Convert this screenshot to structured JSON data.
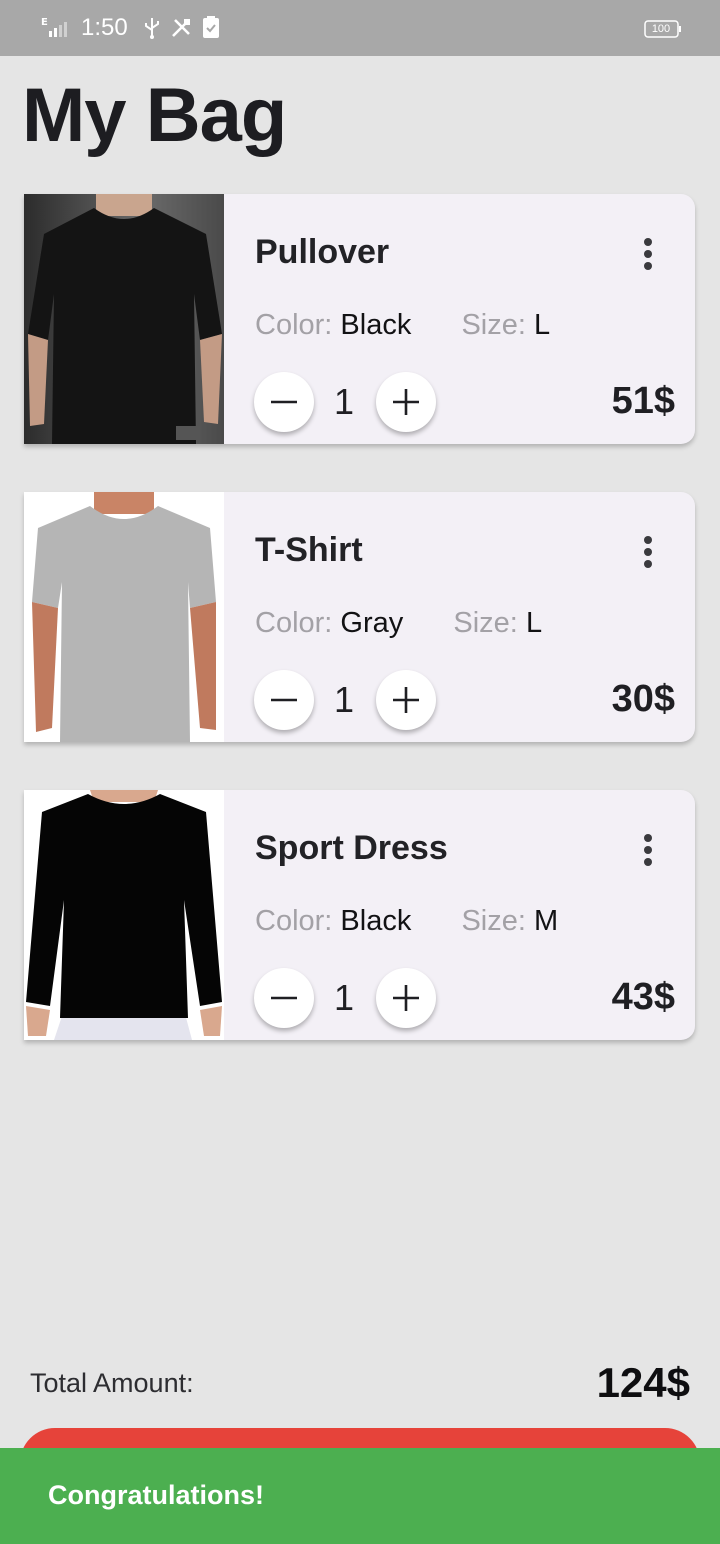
{
  "status_bar": {
    "time": "1:50",
    "network": "E",
    "battery": "100",
    "icons": [
      "signal-icon",
      "usb-icon",
      "tools-icon",
      "clipboard-icon",
      "battery-icon"
    ]
  },
  "page_title": "My Bag",
  "labels": {
    "color": "Color:",
    "size": "Size:"
  },
  "items": [
    {
      "name": "Pullover",
      "color": "Black",
      "size": "L",
      "quantity": "1",
      "price": "51$",
      "image": "black t-shirt photo"
    },
    {
      "name": "T-Shirt",
      "color": "Gray",
      "size": "L",
      "quantity": "1",
      "price": "30$",
      "image": "gray t-shirt photo"
    },
    {
      "name": "Sport Dress",
      "color": "Black",
      "size": "M",
      "quantity": "1",
      "price": "43$",
      "image": "black long-sleeve shirt photo"
    }
  ],
  "total": {
    "label": "Total Amount:",
    "value": "124$"
  },
  "snackbar": {
    "message": "Congratulations!"
  },
  "colors": {
    "background": "#e5e5e5",
    "card": "#f3f0f6",
    "status_bar": "#a8a8a8",
    "checkout_button": "#e6433a",
    "snackbar": "#4caf50"
  }
}
